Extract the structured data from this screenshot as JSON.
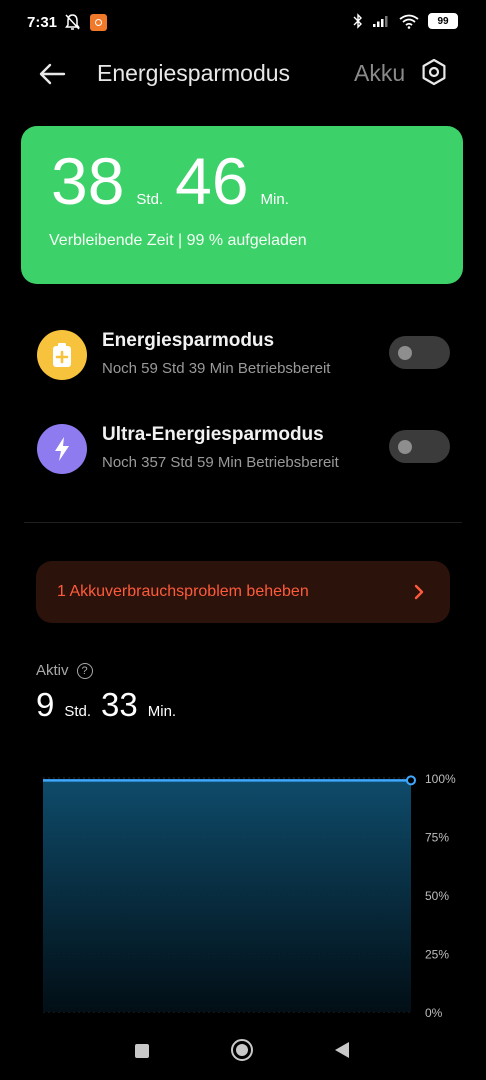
{
  "status_bar": {
    "time": "7:31",
    "battery_level": "99"
  },
  "header": {
    "title": "Energiesparmodus",
    "second_tab": "Akku"
  },
  "remaining": {
    "hours": "38",
    "hours_unit": "Std.",
    "minutes": "46",
    "minutes_unit": "Min.",
    "subtitle": "Verbleibende Zeit | 99 % aufgeladen",
    "card_color": "#3dd16a"
  },
  "modes": [
    {
      "title": "Energiesparmodus",
      "subtitle": "Noch 59 Std 39 Min Betriebsbereit",
      "icon": "battery-plus-icon",
      "icon_color": "#f7c33c",
      "enabled": false
    },
    {
      "title": "Ultra-Energiesparmodus",
      "subtitle": "Noch 357 Std 59 Min Betriebsbereit",
      "icon": "lightning-icon",
      "icon_color": "#8e7bf0",
      "enabled": false
    }
  ],
  "problem_banner": {
    "text": "1 Akkuverbrauchsproblem beheben",
    "color": "#ff5b3b"
  },
  "active": {
    "label": "Aktiv",
    "hours": "9",
    "hours_unit": "Std.",
    "minutes": "33",
    "minutes_unit": "Min."
  },
  "chart_data": {
    "type": "area",
    "y_ticks": [
      "100%",
      "75%",
      "50%",
      "25%",
      "0%"
    ],
    "ylim": [
      0,
      100
    ],
    "x": [
      0,
      1
    ],
    "series": [
      {
        "values": [
          99,
          99
        ]
      }
    ],
    "grid": true,
    "line_color": "#3ea8ff"
  }
}
